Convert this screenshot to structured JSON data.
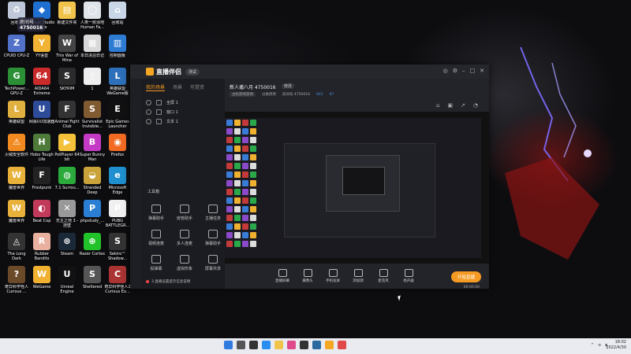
{
  "desktop_icons": [
    {
      "label": "回收站",
      "color": "#bfc8d8",
      "glyph": "♻"
    },
    {
      "label": "Visual Studio Code",
      "color": "#1f6fd0",
      "glyph": "◆"
    },
    {
      "label": "新建文件夹",
      "color": "#f1c34a",
      "glyph": "▤"
    },
    {
      "label": "人类一败涂地 Human Fa...",
      "color": "#dfe3ea",
      "glyph": "◯"
    },
    {
      "label": "回收站",
      "color": "#c8d6e8",
      "glyph": "⌂"
    },
    {
      "label": "CPUID CPU-Z",
      "color": "#5271c9",
      "glyph": "Z"
    },
    {
      "label": "YY语音",
      "color": "#f1b334",
      "glyph": "Y"
    },
    {
      "label": "This War of Mine",
      "color": "#444",
      "glyph": "W"
    },
    {
      "label": "本日漂泊日记",
      "color": "#d9d9d9",
      "glyph": "▦"
    },
    {
      "label": "控制面板",
      "color": "#2e7bd3",
      "glyph": "▥"
    },
    {
      "label": "TechPower... GPU-Z",
      "color": "#2a8f35",
      "glyph": "G"
    },
    {
      "label": "AIDA64 Extreme",
      "color": "#c92a2a",
      "glyph": "64"
    },
    {
      "label": "SKYRIM",
      "color": "#2b2b2b",
      "glyph": "S"
    },
    {
      "label": "1",
      "color": "#eeeeee",
      "glyph": "▯"
    },
    {
      "label": "英雄联盟 WeGame版",
      "color": "#2d6fb8",
      "glyph": "L"
    },
    {
      "label": "英雄联盟",
      "color": "#e0b040",
      "glyph": "L"
    },
    {
      "label": "网易UU加速器",
      "color": "#2e4b9a",
      "glyph": "U"
    },
    {
      "label": "Animal Fight Club",
      "color": "#333",
      "glyph": "F"
    },
    {
      "label": "Survivalist Invisible...",
      "color": "#805a30",
      "glyph": "S"
    },
    {
      "label": "Epic Games Launcher",
      "color": "#111",
      "glyph": "E"
    },
    {
      "label": "火绒安全软件",
      "color": "#f28a22",
      "glyph": "⚠"
    },
    {
      "label": "Hobo Tough Life",
      "color": "#4e7a3a",
      "glyph": "H"
    },
    {
      "label": "PotPlayer 64 bit",
      "color": "#f3c23a",
      "glyph": "▶"
    },
    {
      "label": "Super Bunny Man",
      "color": "#c43ac4",
      "glyph": "B"
    },
    {
      "label": "Firefox",
      "color": "#f26b22",
      "glyph": "◉"
    },
    {
      "label": "魔兽世界",
      "color": "#e7b13a",
      "glyph": "W"
    },
    {
      "label": "Frostpunk",
      "color": "#222",
      "glyph": "F"
    },
    {
      "label": "7.1 Surrou...",
      "color": "#2aaa3a",
      "glyph": "◍"
    },
    {
      "label": "Stranded Deep",
      "color": "#c9a33a",
      "glyph": "◒"
    },
    {
      "label": "Microsoft Edge",
      "color": "#1f8fcf",
      "glyph": "e"
    },
    {
      "label": "魔兽世界",
      "color": "#e7b13a",
      "glyph": "W"
    },
    {
      "label": "Beat Cop",
      "color": "#c23a5a",
      "glyph": "◐"
    },
    {
      "label": "无主之地 3 - 挂壁",
      "color": "#999",
      "glyph": "✕"
    },
    {
      "label": "phpstudy_...",
      "color": "#2a7ed3",
      "glyph": "P"
    },
    {
      "label": "PUBG BATTLEGR...",
      "color": "#f0f0f0",
      "glyph": "P"
    },
    {
      "label": "The Long Dark",
      "color": "#333",
      "glyph": "◬"
    },
    {
      "label": "Rubber Bandits",
      "color": "#e9b0a0",
      "glyph": "R"
    },
    {
      "label": "Steam",
      "color": "#1b2838",
      "glyph": "⊛"
    },
    {
      "label": "Razer Cortex",
      "color": "#21c22a",
      "glyph": "⊕"
    },
    {
      "label": "Sekiro™ Shadow...",
      "color": "#333",
      "glyph": "S"
    },
    {
      "label": "奇异科学怪人 Curious ...",
      "color": "#6b4a2a",
      "glyph": "?"
    },
    {
      "label": "WeGame",
      "color": "#f0b030",
      "glyph": "W"
    },
    {
      "label": "Unreal Engine",
      "color": "#111",
      "glyph": "U"
    },
    {
      "label": "Sheltered",
      "color": "#555",
      "glyph": "S"
    },
    {
      "label": "奇异科学怪人2 Curious Ex...",
      "color": "#a33",
      "glyph": "C"
    }
  ],
  "overlay_badge": {
    "text": "房间号",
    "number": "4750016"
  },
  "app": {
    "title": "直播伴侣",
    "badge": "测试",
    "left_tabs": [
      "我的场景",
      "场景",
      "可提资"
    ],
    "sources": [
      "全屏 1",
      "窗口 1",
      "文本 1"
    ],
    "tools_header": "工具箱",
    "tools": [
      "弹幕助手",
      "房管助手",
      "主播任务",
      "视频连麦",
      "多人连麦",
      "弹幕助手",
      "投弹幕",
      "虚拟形象",
      "屏幕共享"
    ],
    "footer_tip": "3.直播设置提示信息说明",
    "room_title": "新人播八月 4750016",
    "room_edit": "修改",
    "room_line2": {
      "category": "主机游戏游戏",
      "edit": "分类修改",
      "room_no": "房间号 4750016",
      "views": "863",
      "count": "87"
    },
    "controls": [
      "直播屏幕",
      "摄像头",
      "手机投屏",
      "添加源",
      "麦克风",
      "扬声器"
    ],
    "start_button": "开始直播",
    "live_time": "00:00:00"
  },
  "clock": {
    "time": "18:02",
    "date": "2022/4/30"
  }
}
